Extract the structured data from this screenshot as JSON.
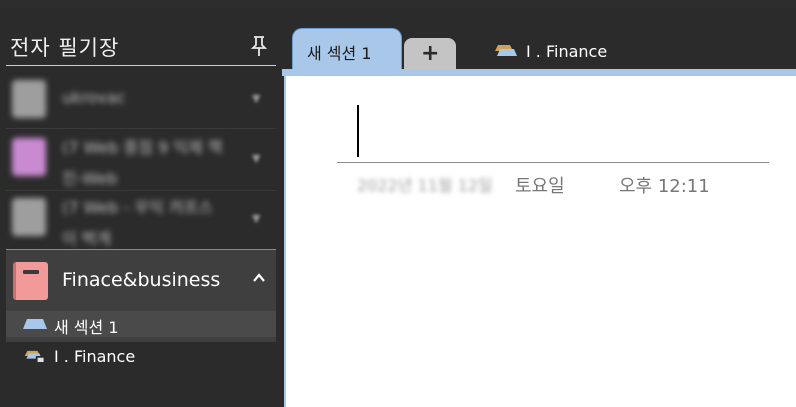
{
  "sidebar": {
    "title": "전자 필기장",
    "blurred_notebooks": [
      {
        "label": "ukrovac",
        "icon_color": "#9e9e9e"
      },
      {
        "label": "(7 Web 중점 9 익제 책진-Web",
        "icon_color": "#c98ad1"
      },
      {
        "label": "(7 Web - 우익 캬프스 이 벅게",
        "icon_color": "#9e9e9e"
      }
    ],
    "active_notebook": {
      "name": "Finace&business",
      "icon_color": "#f29a9a"
    },
    "sections": [
      {
        "label": "새 섹션 1"
      },
      {
        "label": "I . Finance"
      }
    ]
  },
  "tabs": {
    "active_tab": "새 섹션 1",
    "add_tab": "+",
    "section_group": "I . Finance"
  },
  "page": {
    "date": "2022년 11월 12일",
    "weekday": "토요일",
    "time": "오후 12:11"
  }
}
